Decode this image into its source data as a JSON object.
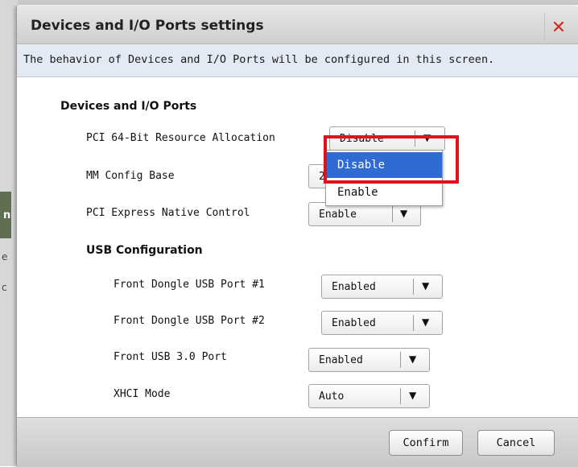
{
  "dialog": {
    "title": "Devices and I/O Ports settings",
    "close_icon": "close-icon",
    "subtitle": "The behavior of Devices and I/O Ports will be configured in this screen."
  },
  "sections": {
    "devices_header": "Devices and I/O Ports",
    "usb_header": "USB Configuration"
  },
  "settings": {
    "pci64": {
      "label": "PCI 64-Bit Resource Allocation",
      "value": "Disable"
    },
    "mmconfig": {
      "label": "MM Config Base",
      "value": "2"
    },
    "pcie_native": {
      "label": "PCI Express Native Control",
      "value": "Enable"
    },
    "usb1": {
      "label": "Front Dongle USB Port #1",
      "value": "Enabled"
    },
    "usb2": {
      "label": "Front Dongle USB Port #2",
      "value": "Enabled"
    },
    "usb3": {
      "label": "Front USB 3.0 Port",
      "value": "Enabled"
    },
    "xhci": {
      "label": "XHCI Mode",
      "value": "Auto"
    }
  },
  "dropdown": {
    "options": [
      "Disable",
      "Enable"
    ],
    "selected": "Disable"
  },
  "footer": {
    "confirm_label": "Confirm",
    "cancel_label": "Cancel"
  },
  "background": {
    "fragment1": "n",
    "fragment2": "e",
    "fragment3": "c"
  },
  "colors": {
    "highlight": "#e2101a",
    "selected_option": "#2f6bd2",
    "close_icon": "#d12a1f"
  }
}
